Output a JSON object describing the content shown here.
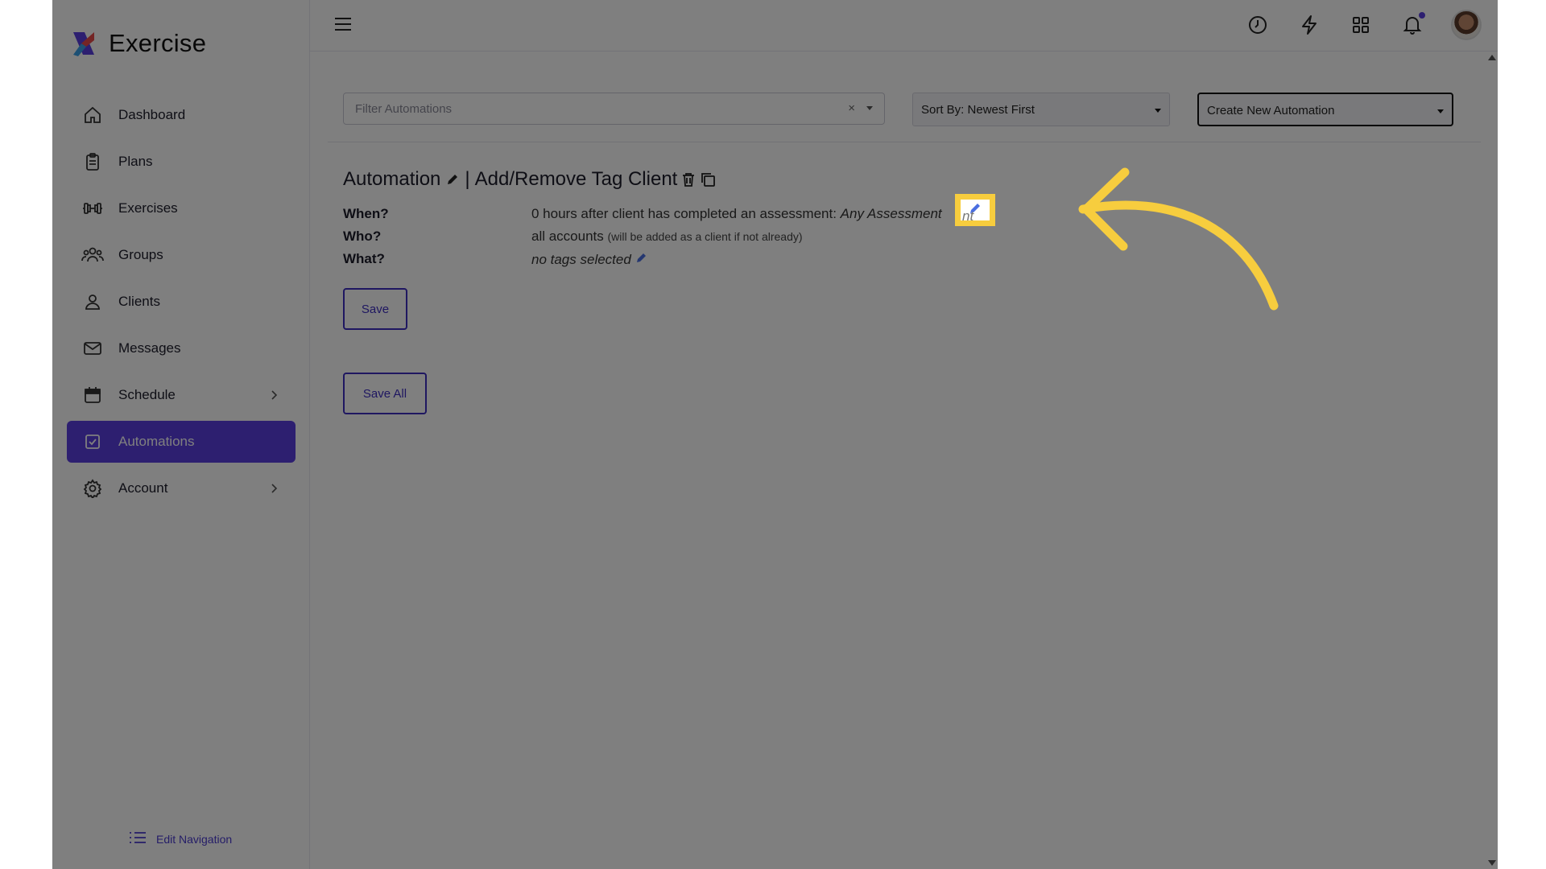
{
  "app": {
    "name": "Exercise"
  },
  "sidebar": {
    "items": [
      {
        "label": "Dashboard",
        "icon": "home-icon"
      },
      {
        "label": "Plans",
        "icon": "clipboard-icon"
      },
      {
        "label": "Exercises",
        "icon": "dumbbell-icon"
      },
      {
        "label": "Groups",
        "icon": "group-icon"
      },
      {
        "label": "Clients",
        "icon": "person-icon"
      },
      {
        "label": "Messages",
        "icon": "mail-icon"
      },
      {
        "label": "Schedule",
        "icon": "calendar-icon"
      },
      {
        "label": "Automations",
        "icon": "checkbox-icon"
      },
      {
        "label": "Account",
        "icon": "gear-icon"
      }
    ],
    "edit_nav_label": "Edit Navigation"
  },
  "toolbar": {
    "filter_placeholder": "Filter Automations",
    "filter_clear": "×",
    "sort_label": "Sort By: Newest First",
    "create_label": "Create New Automation"
  },
  "automation": {
    "title_prefix": "Automation",
    "separator": "|",
    "name": "Add/Remove Tag Client",
    "when_label": "When?",
    "when_value": "0 hours after client has completed an assessment:",
    "when_assessment": "Any Assessment",
    "who_label": "Who?",
    "who_value": "all accounts",
    "who_note": "(will be added as a client if not already)",
    "what_label": "What?",
    "what_value": "no tags selected"
  },
  "buttons": {
    "save": "Save",
    "save_all": "Save All"
  },
  "highlight": {
    "peek_text": "nt"
  },
  "colors": {
    "accent": "#5a3fe0",
    "button_border": "#3e2fc2",
    "highlight": "#f7cd3e"
  }
}
